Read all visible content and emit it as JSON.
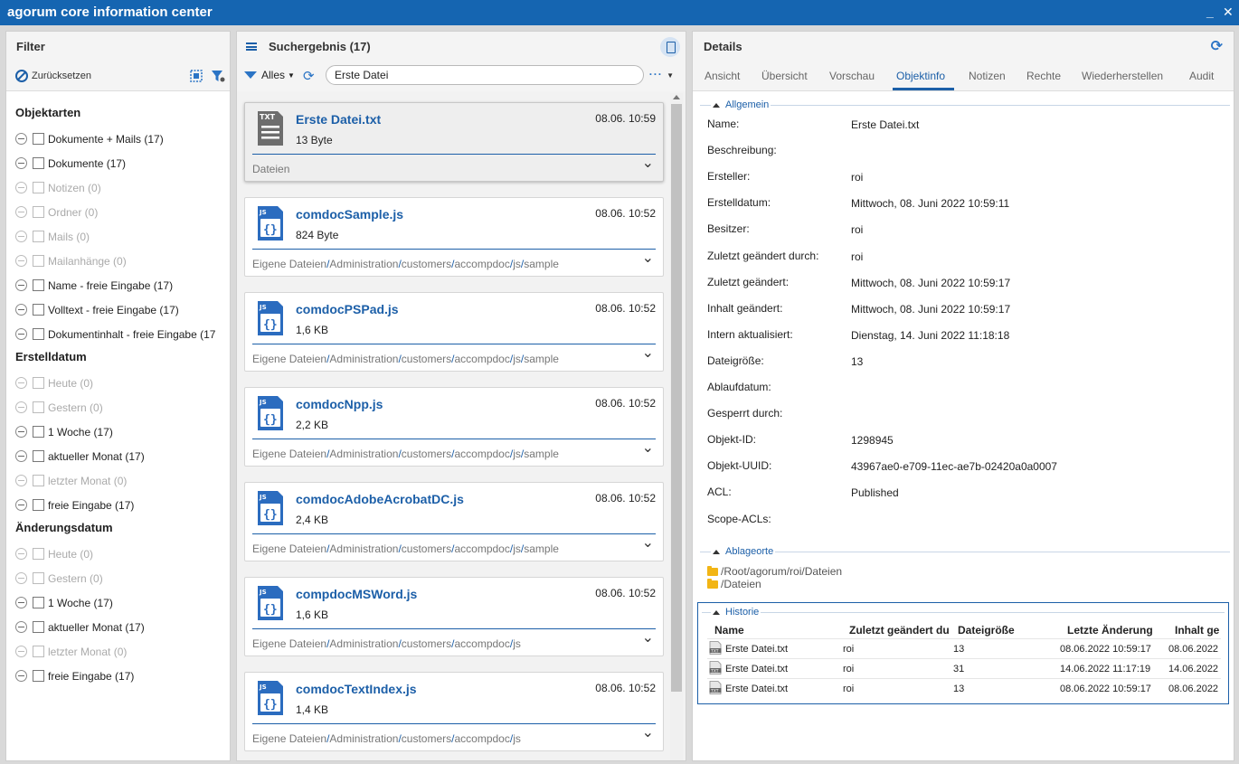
{
  "app": {
    "title": "agorum core information center"
  },
  "window": {
    "minimize": "_",
    "close": "✕"
  },
  "filter": {
    "title": "Filter",
    "reset_label": "Zurücksetzen",
    "groups": [
      {
        "label": "Objektarten",
        "items": [
          {
            "label": "Dokumente + Mails (17)",
            "enabled": true
          },
          {
            "label": "Dokumente (17)",
            "enabled": true
          },
          {
            "label": "Notizen (0)",
            "enabled": false
          },
          {
            "label": "Ordner (0)",
            "enabled": false
          },
          {
            "label": "Mails (0)",
            "enabled": false
          },
          {
            "label": "Mailanhänge (0)",
            "enabled": false
          },
          {
            "label": "Name - freie Eingabe (17)",
            "enabled": true
          },
          {
            "label": "Volltext - freie Eingabe (17)",
            "enabled": true
          },
          {
            "label": "Dokumentinhalt - freie Eingabe (17",
            "enabled": true
          }
        ]
      },
      {
        "label": "Erstelldatum",
        "items": [
          {
            "label": "Heute (0)",
            "enabled": false
          },
          {
            "label": "Gestern (0)",
            "enabled": false
          },
          {
            "label": "1 Woche (17)",
            "enabled": true
          },
          {
            "label": "aktueller Monat (17)",
            "enabled": true
          },
          {
            "label": "letzter Monat (0)",
            "enabled": false
          },
          {
            "label": "freie Eingabe (17)",
            "enabled": true
          }
        ]
      },
      {
        "label": "Änderungsdatum",
        "items": [
          {
            "label": "Heute (0)",
            "enabled": false
          },
          {
            "label": "Gestern (0)",
            "enabled": false
          },
          {
            "label": "1 Woche (17)",
            "enabled": true
          },
          {
            "label": "aktueller Monat (17)",
            "enabled": true
          },
          {
            "label": "letzter Monat (0)",
            "enabled": false
          },
          {
            "label": "freie Eingabe (17)",
            "enabled": true
          }
        ]
      }
    ]
  },
  "results": {
    "title": "Suchergebnis (17)",
    "scope_label": "Alles",
    "search_value": "Erste Datei",
    "more_label": "···",
    "items": [
      {
        "name": "Erste Datei.txt",
        "size": "13 Byte",
        "date": "08.06. 10:59",
        "path": [
          "Dateien"
        ],
        "type": "txt",
        "selected": true
      },
      {
        "name": "comdocSample.js",
        "size": "824 Byte",
        "date": "08.06. 10:52",
        "path": [
          "Eigene Dateien",
          "Administration",
          "customers",
          "accompdoc",
          "js",
          "sample"
        ],
        "type": "js",
        "selected": false
      },
      {
        "name": "comdocPSPad.js",
        "size": "1,6 KB",
        "date": "08.06. 10:52",
        "path": [
          "Eigene Dateien",
          "Administration",
          "customers",
          "accompdoc",
          "js",
          "sample"
        ],
        "type": "js",
        "selected": false
      },
      {
        "name": "comdocNpp.js",
        "size": "2,2 KB",
        "date": "08.06. 10:52",
        "path": [
          "Eigene Dateien",
          "Administration",
          "customers",
          "accompdoc",
          "js",
          "sample"
        ],
        "type": "js",
        "selected": false
      },
      {
        "name": "comdocAdobeAcrobatDC.js",
        "size": "2,4 KB",
        "date": "08.06. 10:52",
        "path": [
          "Eigene Dateien",
          "Administration",
          "customers",
          "accompdoc",
          "js",
          "sample"
        ],
        "type": "js",
        "selected": false
      },
      {
        "name": "compdocMSWord.js",
        "size": "1,6 KB",
        "date": "08.06. 10:52",
        "path": [
          "Eigene Dateien",
          "Administration",
          "customers",
          "accompdoc",
          "js"
        ],
        "type": "js",
        "selected": false
      },
      {
        "name": "comdocTextIndex.js",
        "size": "1,4 KB",
        "date": "08.06. 10:52",
        "path": [
          "Eigene Dateien",
          "Administration",
          "customers",
          "accompdoc",
          "js"
        ],
        "type": "js",
        "selected": false
      }
    ]
  },
  "details": {
    "title": "Details",
    "tabs": [
      "Ansicht",
      "Übersicht",
      "Vorschau",
      "Objektinfo",
      "Notizen",
      "Rechte",
      "Wiederherstellen",
      "Audit"
    ],
    "active_tab": "Objektinfo",
    "general_title": "Allgemein",
    "props": [
      {
        "label": "Name:",
        "value": "Erste Datei.txt"
      },
      {
        "label": "Beschreibung:",
        "value": ""
      },
      {
        "label": "Ersteller:",
        "value": "roi"
      },
      {
        "label": "Erstelldatum:",
        "value": "Mittwoch, 08. Juni 2022 10:59:11"
      },
      {
        "label": "Besitzer:",
        "value": "roi"
      },
      {
        "label": "Zuletzt geändert durch:",
        "value": "roi"
      },
      {
        "label": "Zuletzt geändert:",
        "value": "Mittwoch, 08. Juni 2022 10:59:17"
      },
      {
        "label": "Inhalt geändert:",
        "value": "Mittwoch, 08. Juni 2022 10:59:17"
      },
      {
        "label": "Intern aktualisiert:",
        "value": "Dienstag, 14. Juni 2022 11:18:18"
      },
      {
        "label": "Dateigröße:",
        "value": "13"
      },
      {
        "label": "Ablaufdatum:",
        "value": ""
      },
      {
        "label": "Gesperrt durch:",
        "value": ""
      },
      {
        "label": "Objekt-ID:",
        "value": "1298945"
      },
      {
        "label": "Objekt-UUID:",
        "value": "43967ae0-e709-11ec-ae7b-02420a0a0007"
      },
      {
        "label": "ACL:",
        "value": "Published"
      },
      {
        "label": "Scope-ACLs:",
        "value": ""
      }
    ],
    "locations_title": "Ablageorte",
    "locations": [
      "/Root/agorum/roi/Dateien",
      "/Dateien"
    ],
    "history_title": "Historie",
    "history_columns": [
      "Name",
      "Zuletzt geändert du",
      "Dateigröße",
      "Letzte Änderung",
      "Inhalt ge"
    ],
    "history_rows": [
      [
        "Erste Datei.txt",
        "roi",
        "13",
        "08.06.2022 10:59:17",
        "08.06.2022"
      ],
      [
        "Erste Datei.txt",
        "roi",
        "31",
        "14.06.2022 11:17:19",
        "14.06.2022"
      ],
      [
        "Erste Datei.txt",
        "roi",
        "13",
        "08.06.2022 10:59:17",
        "08.06.2022"
      ]
    ]
  }
}
